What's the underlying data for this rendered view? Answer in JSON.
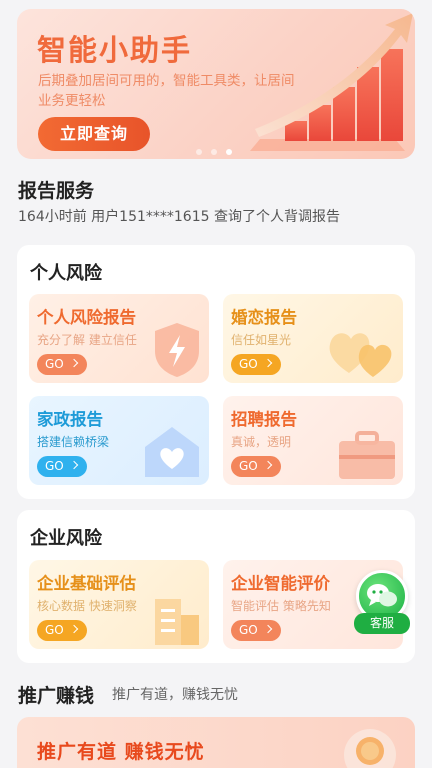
{
  "banner": {
    "title": "智能小助手",
    "desc": "后期叠加居间可用的，智能工具类，让居间业务更轻松",
    "button": "立即查询"
  },
  "report_service": {
    "title": "报告服务",
    "notice": "164小时前 用户151****1615 查询了个人背调报告"
  },
  "personal_risk": {
    "title": "个人风险",
    "tiles": [
      {
        "title": "个人风险报告",
        "sub": "充分了解 建立信任",
        "go": "GO",
        "icon": "shield-bolt-icon"
      },
      {
        "title": "婚恋报告",
        "sub": "信任如星光",
        "go": "GO",
        "icon": "hearts-icon"
      },
      {
        "title": "家政报告",
        "sub": "搭建信赖桥梁",
        "go": "GO",
        "icon": "house-heart-icon"
      },
      {
        "title": "招聘报告",
        "sub": "真诚，透明",
        "go": "GO",
        "icon": "briefcase-icon"
      }
    ]
  },
  "enterprise_risk": {
    "title": "企业风险",
    "tiles": [
      {
        "title": "企业基础评估",
        "sub": "核心数据 快速洞察",
        "go": "GO",
        "icon": "building-icon"
      },
      {
        "title": "企业智能评价",
        "sub": "智能评估 策略先知",
        "go": "GO",
        "icon": "chart-icon"
      }
    ]
  },
  "customer_service": {
    "label": "客服"
  },
  "promotion": {
    "title": "推广赚钱",
    "subtitle": "推广有道，赚钱无忧",
    "banner_title": "推广有道 赚钱无忧"
  },
  "colors": {
    "accent": "#f06a3c",
    "service_green": "#1fae42"
  }
}
